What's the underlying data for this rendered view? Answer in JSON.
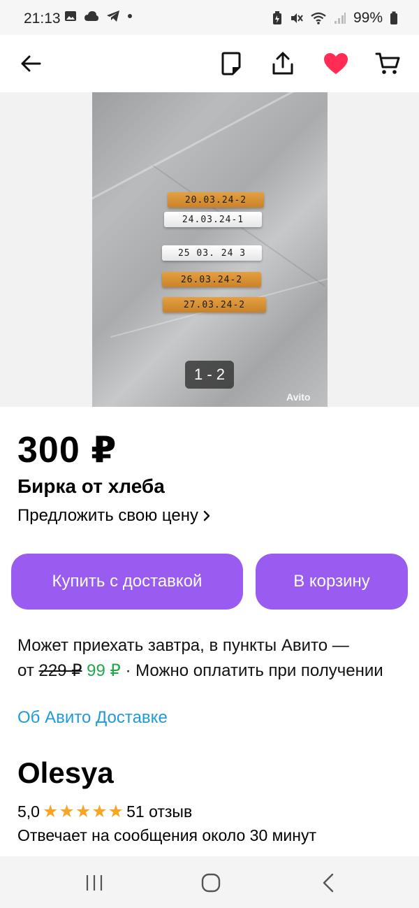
{
  "status_bar": {
    "time": "21:13",
    "battery": "99%"
  },
  "product": {
    "price": "300 ₽",
    "title": "Бирка от хлеба",
    "offer_price": "Предложить свою цену",
    "image_counter": "1 - 2",
    "watermark": "Avito",
    "tags": [
      "20.03.24-2",
      "24.03.24-1",
      "25 03. 24 3",
      "26.03.24-2",
      "27.03.24-2"
    ]
  },
  "actions": {
    "buy_with_delivery": "Купить с доставкой",
    "to_cart": "В корзину"
  },
  "delivery": {
    "line1": "Может приехать завтра, в пункты Авито —",
    "from": "от",
    "old_price": "229 ₽",
    "new_price": "99 ₽",
    "payment_note": "· Можно оплатить при получении",
    "link": "Об Авито Доставке"
  },
  "seller": {
    "name": "Olesya",
    "rating": "5,0",
    "stars": 5,
    "reviews": "51 отзыв",
    "response_time": "Отвечает на сообщения около 30 минут"
  },
  "colors": {
    "primary_button": "#9a5cf0",
    "favorite": "#ff2d55",
    "link": "#1e9bd8",
    "discount": "#20a94a",
    "star": "#f6a623"
  },
  "icons": [
    "back-arrow-icon",
    "note-icon",
    "share-icon",
    "favorite-heart-icon",
    "cart-icon"
  ]
}
